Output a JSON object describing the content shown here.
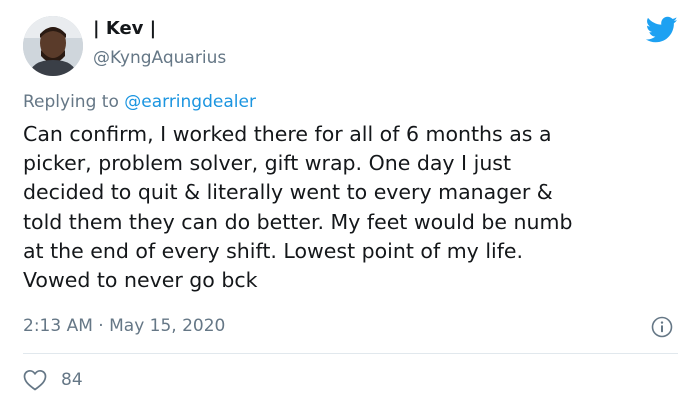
{
  "tweet": {
    "author": {
      "display_name": "| Kev |",
      "handle": "@KyngAquarius"
    },
    "reply_prefix": "Replying to ",
    "reply_to": "@earringdealer",
    "text_lines": [
      "Can confirm, I worked there for all of 6 months as a",
      "picker, problem solver, gift wrap. One day I just",
      "decided to quit & literally went to every manager &",
      "told them they can do better. My feet would be numb",
      "at the end of every shift. Lowest point of my life.",
      "Vowed to never go bck"
    ],
    "time": "2:13 AM",
    "separator": "·",
    "date": "May 15, 2020",
    "likes": "84"
  },
  "icons": {
    "brand": "twitter-bird-icon",
    "info": "info-icon",
    "like": "heart-icon"
  },
  "colors": {
    "brand_blue": "#1da1f2",
    "link_blue": "#1b95e0",
    "secondary_text": "#657786",
    "primary_text": "#14171a",
    "divider": "#e1e8ed"
  }
}
